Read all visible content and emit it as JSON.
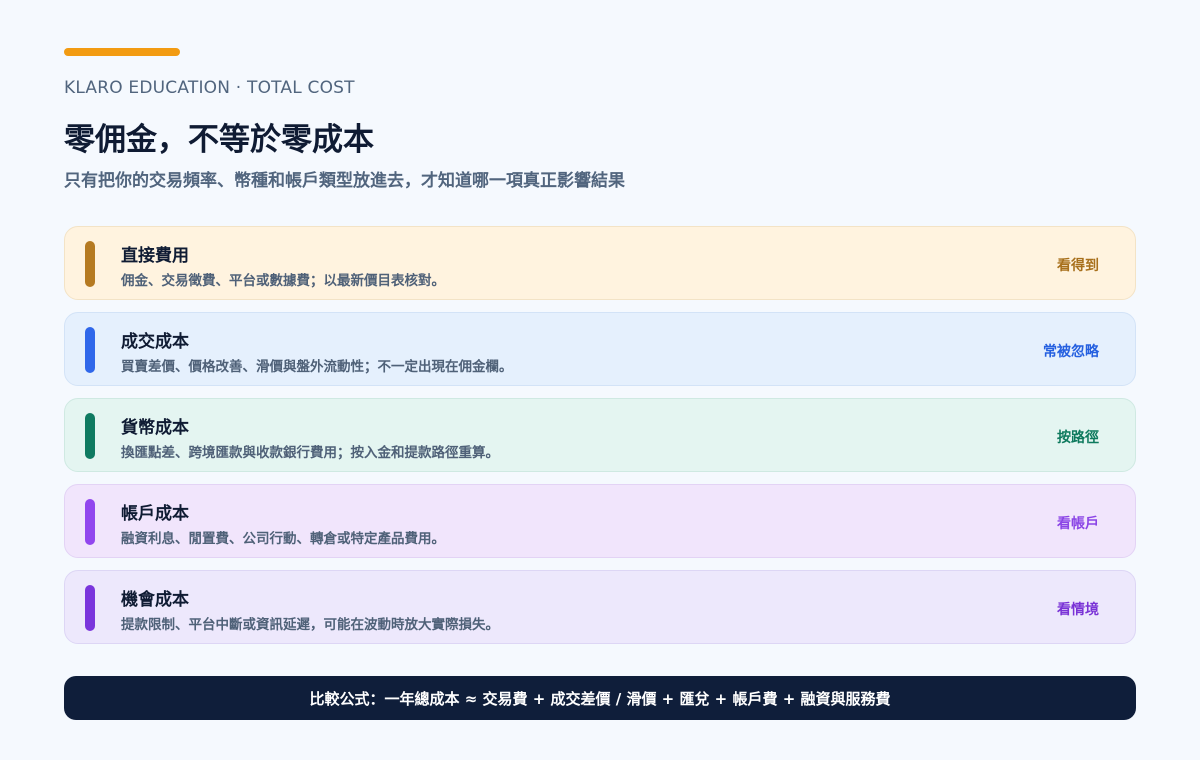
{
  "header": {
    "kicker": "KLARO EDUCATION · TOTAL COST",
    "title": "零佣金，不等於零成本",
    "subtitle": "只有把你的交易頻率、幣種和帳戶類型放進去，才知道哪一項真正影響結果"
  },
  "cards": [
    {
      "label": "直接費用",
      "desc": "佣金、交易徵費、平台或數據費；以最新價目表核對。",
      "tag": "看得到",
      "stripe_color": "#b57a22",
      "tag_color": "#a8701c",
      "bg_color": "#fff3df",
      "border_color": "#f3e3c6"
    },
    {
      "label": "成交成本",
      "desc": "買賣差價、價格改善、滑價與盤外流動性；不一定出現在佣金欄。",
      "tag": "常被忽略",
      "stripe_color": "#2f67ea",
      "tag_color": "#2560e0",
      "bg_color": "#e5f0fd",
      "border_color": "#d3e3f7"
    },
    {
      "label": "貨幣成本",
      "desc": "換匯點差、跨境匯款與收款銀行費用；按入金和提款路徑重算。",
      "tag": "按路徑",
      "stripe_color": "#0f7a61",
      "tag_color": "#0e7a5e",
      "bg_color": "#e4f5f1",
      "border_color": "#cfe9e2"
    },
    {
      "label": "帳戶成本",
      "desc": "融資利息、閒置費、公司行動、轉倉或特定產品費用。",
      "tag": "看帳戶",
      "stripe_color": "#9146ee",
      "tag_color": "#8b45e6",
      "bg_color": "#f1e5fc",
      "border_color": "#e3d3f5"
    },
    {
      "label": "機會成本",
      "desc": "提款限制、平台中斷或資訊延遲，可能在波動時放大實際損失。",
      "tag": "看情境",
      "stripe_color": "#7a35dc",
      "tag_color": "#7a33d6",
      "bg_color": "#ede8fc",
      "border_color": "#ddd6f5"
    }
  ],
  "formula": "比較公式：一年總成本 ≈ 交易費 + 成交差價 / 滑價 + 匯兌 + 帳戶費 + 融資與服務費",
  "colors": {
    "accent": "#f29b12",
    "formula_bg": "#0f1e3a"
  }
}
